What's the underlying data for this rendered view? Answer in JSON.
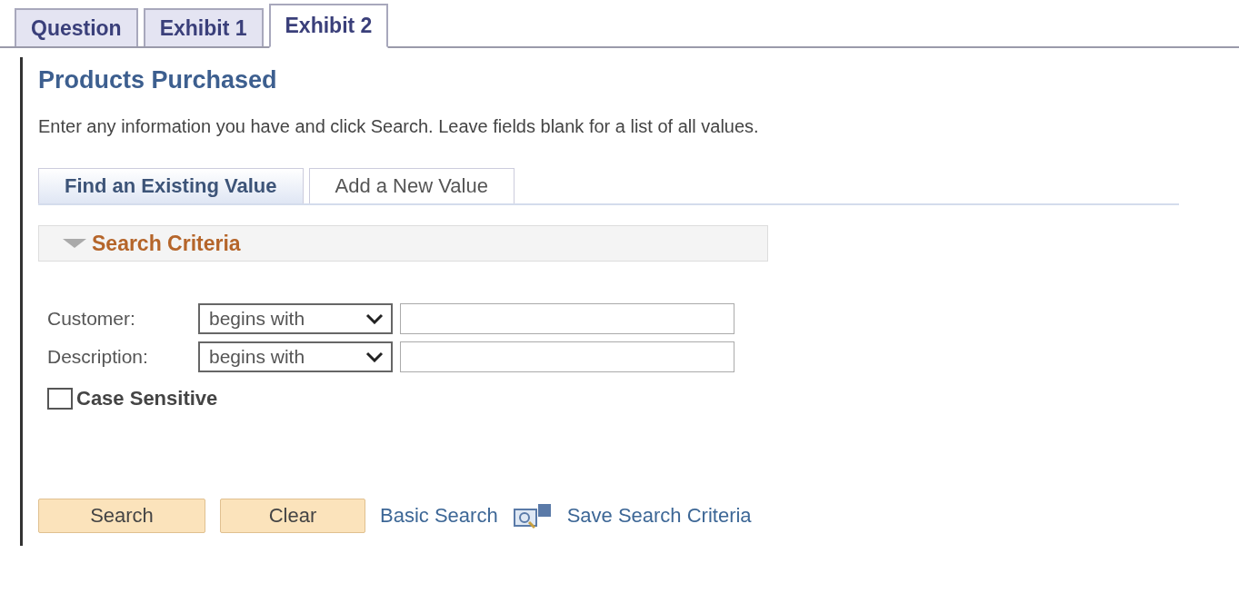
{
  "tabs": [
    {
      "label": "Question",
      "selected": false
    },
    {
      "label": "Exhibit 1",
      "selected": false
    },
    {
      "label": "Exhibit 2",
      "selected": true
    }
  ],
  "page_title": "Products Purchased",
  "instructions": "Enter any information you have and click Search. Leave fields blank for a list of all values.",
  "sub_tabs": [
    {
      "label": "Find an Existing Value",
      "selected": true
    },
    {
      "label": "Add a New Value",
      "selected": false
    }
  ],
  "section": {
    "title": "Search Criteria",
    "expanded": true
  },
  "fields": [
    {
      "label": "Customer:",
      "operator": "begins with"
    },
    {
      "label": "Description:",
      "operator": "begins with"
    }
  ],
  "case_sensitive": {
    "label": "Case Sensitive",
    "checked": false
  },
  "buttons": [
    "Search",
    "Clear"
  ],
  "links": {
    "basic_search": "Basic Search",
    "save_search": "Save Search Criteria"
  }
}
